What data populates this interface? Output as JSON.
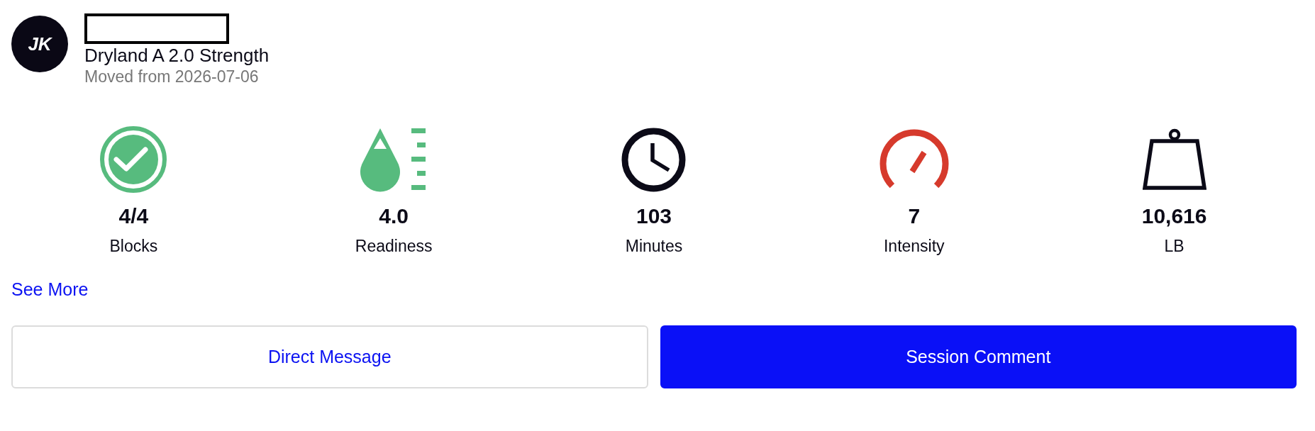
{
  "avatar": {
    "initials": "JK"
  },
  "session": {
    "title": "Dryland A 2.0 Strength",
    "subtitle": "Moved from 2026-07-06"
  },
  "stats": [
    {
      "kind": "check",
      "value": "4/4",
      "label": "Blocks"
    },
    {
      "kind": "drop",
      "value": "4.0",
      "label": "Readiness"
    },
    {
      "kind": "clock",
      "value": "103",
      "label": "Minutes"
    },
    {
      "kind": "gauge",
      "value": "7",
      "label": "Intensity"
    },
    {
      "kind": "weight",
      "value": "10,616",
      "label": "LB"
    }
  ],
  "see_more": {
    "label": "See More"
  },
  "buttons": [
    {
      "kind": "outline",
      "label": "Direct Message"
    },
    {
      "kind": "primary",
      "label": "Session Comment"
    }
  ]
}
